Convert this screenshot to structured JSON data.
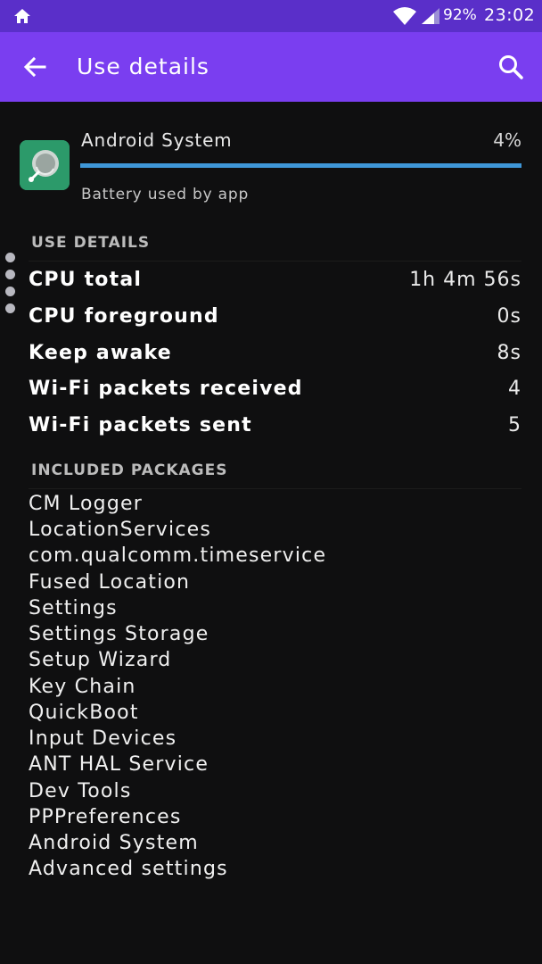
{
  "status_bar": {
    "battery": "92%",
    "time": "23:02"
  },
  "app_bar": {
    "title": "Use details"
  },
  "app": {
    "name": "Android System",
    "percent": "4%",
    "percent_value": 4,
    "subtitle": "Battery used by app"
  },
  "use_details": {
    "header": "USE DETAILS",
    "rows": [
      {
        "label": "CPU total",
        "value": "1h 4m 56s"
      },
      {
        "label": "CPU foreground",
        "value": "0s"
      },
      {
        "label": "Keep awake",
        "value": "8s"
      },
      {
        "label": "Wi-Fi packets received",
        "value": "4"
      },
      {
        "label": "Wi-Fi packets sent",
        "value": "5"
      }
    ]
  },
  "included_packages": {
    "header": "INCLUDED PACKAGES",
    "items": [
      "CM Logger",
      "LocationServices",
      "com.qualcomm.timeservice",
      "Fused Location",
      "Settings",
      "Settings Storage",
      "Setup Wizard",
      "Key Chain",
      "QuickBoot",
      "Input Devices",
      "ANT HAL Service",
      "Dev Tools",
      "PPPreferences",
      "Android System",
      "Advanced settings"
    ]
  },
  "colors": {
    "status_bar": "#5a2fc9",
    "app_bar": "#7a3ef0",
    "progress": "#3f97d8",
    "background": "#0f0f10"
  }
}
